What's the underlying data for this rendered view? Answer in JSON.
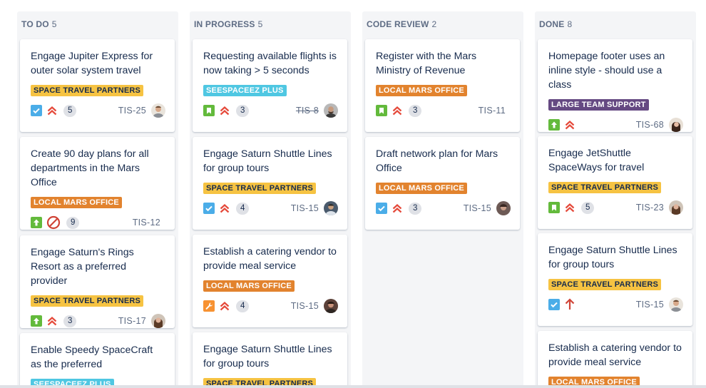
{
  "columns": [
    {
      "title": "TO DO",
      "count": "5",
      "cards": [
        {
          "title": "Engage Jupiter Express for outer solar system travel",
          "label": "SPACE TRAVEL PARTNERS",
          "label_color": "#f6c342",
          "type": "task",
          "priority": "high",
          "points": "5",
          "key": "TIS-25",
          "key_done": false,
          "avatar": "a1"
        },
        {
          "title": "Create 90 day plans for all departments in the Mars Office",
          "label": "LOCAL MARS OFFICE",
          "label_color": "#e2832e",
          "type": "improvement",
          "priority": "blocker",
          "points": "9",
          "key": "TIS-12",
          "key_done": false,
          "avatar": ""
        },
        {
          "title": "Engage Saturn's Rings Resort as a preferred provider",
          "label": "SPACE TRAVEL PARTNERS",
          "label_color": "#f6c342",
          "type": "improvement",
          "priority": "high",
          "points": "3",
          "key": "TIS-17",
          "key_done": false,
          "avatar": "a2"
        },
        {
          "title": "Enable Speedy SpaceCraft as the preferred",
          "label": "SEESPACEEZ PLUS",
          "label_color": "#4fc7e2",
          "type": "",
          "priority": "",
          "points": "",
          "key": "",
          "key_done": false,
          "avatar": ""
        }
      ]
    },
    {
      "title": "IN PROGRESS",
      "count": "5",
      "cards": [
        {
          "title": "Requesting available flights is now taking > 5 seconds",
          "label": "SEESPACEEZ PLUS",
          "label_color": "#4fc7e2",
          "type": "story",
          "priority": "high",
          "points": "3",
          "key": "TIS-8",
          "key_done": true,
          "avatar": "a3"
        },
        {
          "title": "Engage Saturn Shuttle Lines for group tours",
          "label": "SPACE TRAVEL PARTNERS",
          "label_color": "#f6c342",
          "type": "task",
          "priority": "high",
          "points": "4",
          "key": "TIS-15",
          "key_done": false,
          "avatar": "a4"
        },
        {
          "title": "Establish a catering vendor to provide meal service",
          "label": "LOCAL MARS OFFICE",
          "label_color": "#e2832e",
          "type": "subtask",
          "priority": "high",
          "points": "4",
          "key": "TIS-15",
          "key_done": false,
          "avatar": "a5"
        },
        {
          "title": "Engage Saturn Shuttle Lines for group tours",
          "label": "SPACE TRAVEL PARTNERS",
          "label_color": "#f6c342",
          "type": "",
          "priority": "",
          "points": "",
          "key": "",
          "key_done": false,
          "avatar": ""
        }
      ]
    },
    {
      "title": "CODE REVIEW",
      "count": "2",
      "cards": [
        {
          "title": "Register with the Mars Ministry of Revenue",
          "label": "LOCAL MARS OFFICE",
          "label_color": "#e2832e",
          "type": "story",
          "priority": "high",
          "points": "3",
          "key": "TIS-11",
          "key_done": false,
          "avatar": ""
        },
        {
          "title": "Draft network plan for Mars Office",
          "label": "LOCAL MARS OFFICE",
          "label_color": "#e2832e",
          "type": "task",
          "priority": "high",
          "points": "3",
          "key": "TIS-15",
          "key_done": false,
          "avatar": "a6"
        }
      ]
    },
    {
      "title": "DONE",
      "count": "8",
      "cards": [
        {
          "title": "Homepage footer uses an inline style - should use a class",
          "label": "LARGE TEAM SUPPORT",
          "label_color": "#654982",
          "type": "improvement",
          "priority": "high",
          "points": "",
          "key": "TIS-68",
          "key_done": false,
          "avatar": "a7"
        },
        {
          "title": "Engage JetShuttle SpaceWays for travel",
          "label": "SPACE TRAVEL PARTNERS",
          "label_color": "#f6c342",
          "type": "story",
          "priority": "high",
          "points": "5",
          "key": "TIS-23",
          "key_done": false,
          "avatar": "a2"
        },
        {
          "title": "Engage Saturn Shuttle Lines for group tours",
          "label": "SPACE TRAVEL PARTNERS",
          "label_color": "#f6c342",
          "type": "task",
          "priority": "critical",
          "points": "",
          "key": "TIS-15",
          "key_done": false,
          "avatar": "a1"
        },
        {
          "title": "Establish a catering vendor to provide meal service",
          "label": "LOCAL MARS OFFICE",
          "label_color": "#e2832e",
          "type": "",
          "priority": "",
          "points": "",
          "key": "",
          "key_done": false,
          "avatar": ""
        }
      ]
    }
  ]
}
